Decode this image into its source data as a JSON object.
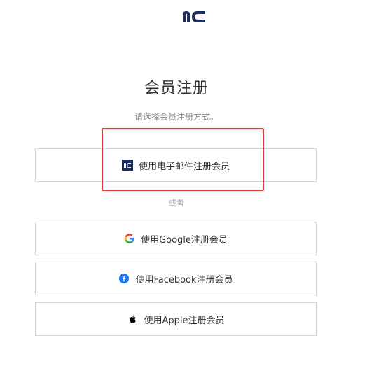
{
  "header": {
    "logo_icon": "nc-logo-icon",
    "logo_text": "nc"
  },
  "main": {
    "title": "会员注册",
    "subtitle": "请选择会员注册方式。",
    "divider_text": "或者",
    "buttons": [
      {
        "label": "使用电子邮件注册会员",
        "icon": "nc-logo-icon"
      },
      {
        "label": "使用Google注册会员",
        "icon": "google-icon"
      },
      {
        "label": "使用Facebook注册会员",
        "icon": "facebook-icon"
      },
      {
        "label": "使用Apple注册会员",
        "icon": "apple-icon"
      }
    ]
  },
  "colors": {
    "brand": "#1a2b5c",
    "highlight": "#e53935",
    "facebook": "#1877f2"
  }
}
